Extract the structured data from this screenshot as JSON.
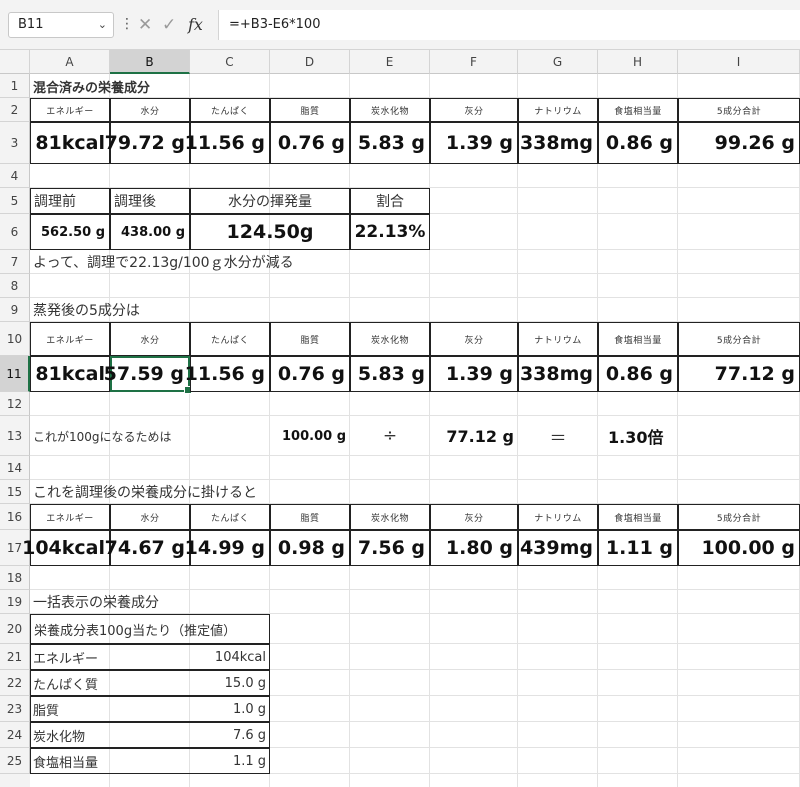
{
  "formula_bar": {
    "name_box": "B11",
    "formula": "=+B3-E6*100",
    "cancel_glyph": "✕",
    "enter_glyph": "✓",
    "fx_glyph": "fx"
  },
  "columns": [
    "A",
    "B",
    "C",
    "D",
    "E",
    "F",
    "G",
    "H",
    "I"
  ],
  "rows": [
    "1",
    "2",
    "3",
    "4",
    "5",
    "6",
    "7",
    "8",
    "9",
    "10",
    "11",
    "12",
    "13",
    "14",
    "15",
    "16",
    "17",
    "18",
    "19",
    "20",
    "21",
    "22",
    "23",
    "24",
    "25"
  ],
  "selected_column": "B",
  "selected_row": "11",
  "sheet": {
    "title": "混合済みの栄養成分",
    "nutrient_headers": [
      "エネルギー",
      "水分",
      "たんぱく",
      "脂質",
      "炭水化物",
      "灰分",
      "ナトリウム",
      "食塩相当量",
      "5成分合計"
    ],
    "row3_values": [
      "81kcal",
      "79.72 g",
      "11.56 g",
      "0.76 g",
      "5.83 g",
      "1.39 g",
      "338mg",
      "0.86 g",
      "99.26 g"
    ],
    "cook": {
      "before_label": "調理前",
      "after_label": "調理後",
      "evap_label": "水分の揮発量",
      "ratio_label": "割合",
      "before_value": "562.50 g",
      "after_value": "438.00 g",
      "evap_value": "124.50g",
      "ratio_value": "22.13%"
    },
    "row7_text": "よって、調理で22.13g/100ｇ水分が減る",
    "row9_text": "蒸発後の5成分は",
    "row11_values": [
      "81kcal",
      "57.59 g",
      "11.56 g",
      "0.76 g",
      "5.83 g",
      "1.39 g",
      "338mg",
      "0.86 g",
      "77.12 g"
    ],
    "row13": {
      "label": "これが100gになるためは",
      "numerator": "100.00 g",
      "divide": "÷",
      "denominator": "77.12 g",
      "equals": "＝",
      "result": "1.30倍"
    },
    "row15_text": "これを調理後の栄養成分に掛けると",
    "row17_values": [
      "104kcal",
      "74.67 g",
      "14.99 g",
      "0.98 g",
      "7.56 g",
      "1.80 g",
      "439mg",
      "1.11 g",
      "100.00 g"
    ],
    "row19_text": "一括表示の栄養成分",
    "summary": {
      "header": "栄養成分表100g当たり（推定値）",
      "items": [
        {
          "label": "エネルギー",
          "value": "104kcal"
        },
        {
          "label": "たんぱく質",
          "value": "15.0 g"
        },
        {
          "label": "脂質",
          "value": "1.0 g"
        },
        {
          "label": "炭水化物",
          "value": "7.6 g"
        },
        {
          "label": "食塩相当量",
          "value": "1.1 g"
        }
      ]
    }
  }
}
